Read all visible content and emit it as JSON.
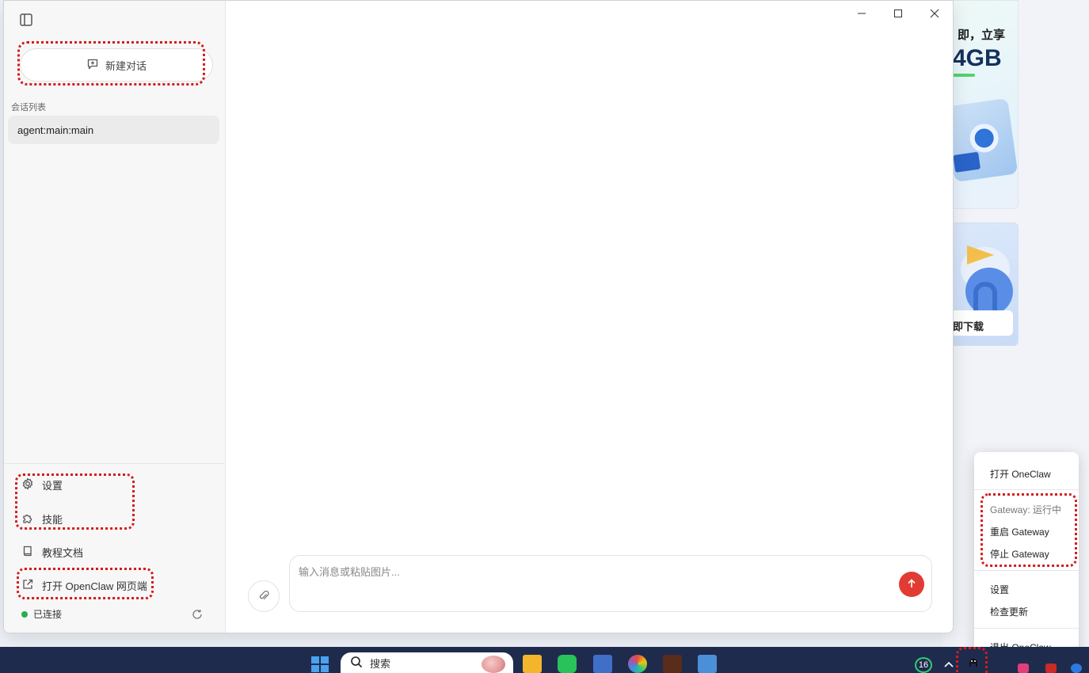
{
  "sidebar": {
    "new_chat_label": "新建对话",
    "section_title": "会话列表",
    "conversations": [
      {
        "label": "agent:main:main"
      }
    ],
    "menu": {
      "settings": "设置",
      "skills": "技能",
      "docs": "教程文档",
      "open_web": "打开 OpenClaw 网页端"
    },
    "status": "已连接"
  },
  "composer": {
    "placeholder": "输入消息或粘贴图片..."
  },
  "background_app": {
    "promo_line1": "即，立享",
    "promo_line2": "4GB",
    "download_label": "即下载"
  },
  "tray_menu": {
    "open": "打开 OneClaw",
    "gateway_status": "Gateway: 运行中",
    "restart_gateway": "重启 Gateway",
    "stop_gateway": "停止 Gateway",
    "settings": "设置",
    "check_update": "检查更新",
    "quit": "退出 OneClaw"
  },
  "taskbar": {
    "search_label": "搜索",
    "notification_count": "16"
  },
  "colors": {
    "accent_send": "#e23b33",
    "status_connected": "#22b14c",
    "annotation_ring": "#d31d1d",
    "taskbar": "#1f2b4d"
  },
  "icons": [
    "sidebar-toggle-icon",
    "chat-plus-icon",
    "gear-icon",
    "puzzle-icon",
    "book-icon",
    "external-link-icon",
    "refresh-icon",
    "paperclip-icon",
    "arrow-up-icon",
    "minimize-icon",
    "maximize-icon",
    "close-icon",
    "windows-start-icon",
    "search-icon"
  ]
}
